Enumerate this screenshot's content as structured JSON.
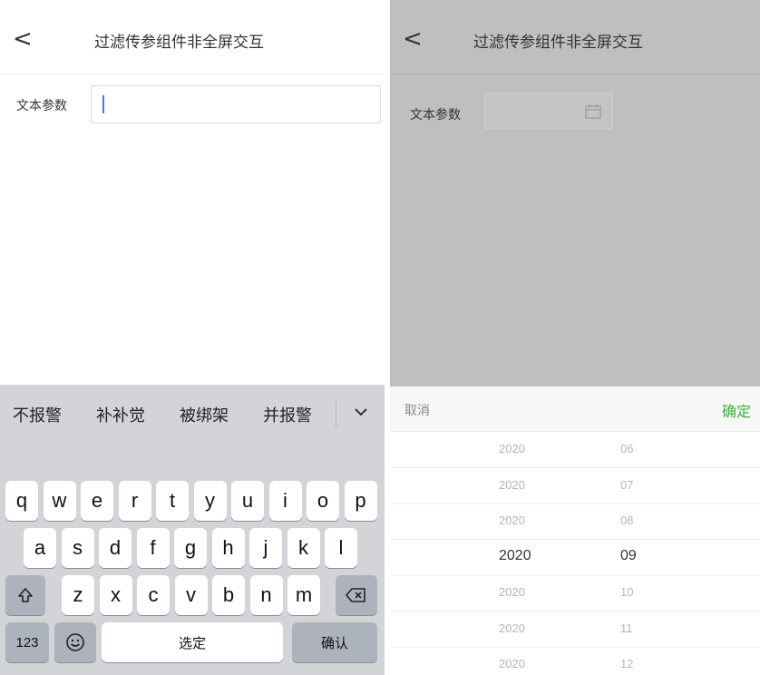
{
  "left": {
    "nav": {
      "back_icon": "chevron-left",
      "back": "<",
      "title": "过滤传参组件非全屏交互"
    },
    "field": {
      "label": "文本参数",
      "value": ""
    },
    "keyboard": {
      "candidates": [
        "不报警",
        "补补觉",
        "被绑架",
        "并报警"
      ],
      "row1": [
        "q",
        "w",
        "e",
        "r",
        "t",
        "y",
        "u",
        "i",
        "o",
        "p"
      ],
      "row2": [
        "a",
        "s",
        "d",
        "f",
        "g",
        "h",
        "j",
        "k",
        "l"
      ],
      "row3": [
        "z",
        "x",
        "c",
        "v",
        "b",
        "n",
        "m"
      ],
      "shift_icon": "shift-icon",
      "delete_icon": "backspace-icon",
      "numbers": "123",
      "emoji_icon": "emoji-icon",
      "space": "选定",
      "confirm": "确认"
    }
  },
  "right": {
    "nav": {
      "back": "<",
      "title": "过滤传参组件非全屏交互"
    },
    "field": {
      "label": "文本参数",
      "icon": "calendar-icon"
    },
    "picker": {
      "cancel": "取消",
      "confirm": "确定",
      "confirm_color": "#3dae3d",
      "rows": [
        {
          "year": "2020",
          "month": "06"
        },
        {
          "year": "2020",
          "month": "07"
        },
        {
          "year": "2020",
          "month": "08"
        },
        {
          "year": "2020",
          "month": "09",
          "selected": true
        },
        {
          "year": "2020",
          "month": "10"
        },
        {
          "year": "2020",
          "month": "11"
        },
        {
          "year": "2020",
          "month": "12"
        }
      ]
    }
  }
}
